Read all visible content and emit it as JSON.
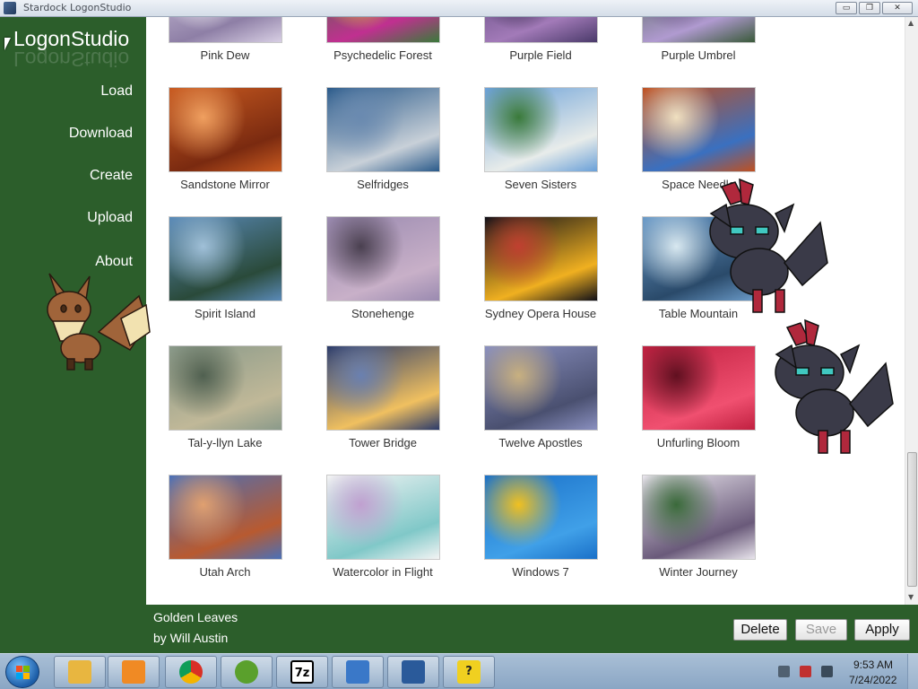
{
  "window": {
    "title": "Stardock LogonStudio",
    "controls": [
      "minimize",
      "maximize",
      "close"
    ],
    "minimize_glyph": "▭",
    "maximize_glyph": "❐",
    "close_glyph": "✕"
  },
  "sidebar": {
    "logo": "LogonStudio",
    "items": [
      {
        "label": "Load"
      },
      {
        "label": "Download"
      },
      {
        "label": "Create"
      },
      {
        "label": "Upload"
      },
      {
        "label": "About"
      }
    ],
    "background": "#2c5e2b"
  },
  "gallery": {
    "tiles": [
      {
        "label": "Pink Dew",
        "colors": [
          "#d8cfe4",
          "#8e7fa6",
          "#ffffff"
        ]
      },
      {
        "label": "Psychedelic Forest",
        "colors": [
          "#3a7a3a",
          "#c03090",
          "#f2d13a"
        ]
      },
      {
        "label": "Purple Field",
        "colors": [
          "#4a3a6a",
          "#a27ab8",
          "#2c2040"
        ]
      },
      {
        "label": "Purple Umbrel",
        "colors": [
          "#3a5a3a",
          "#b09ad0",
          "#6a4a8a"
        ]
      },
      {
        "label": "Sandstone Mirror",
        "colors": [
          "#c85a20",
          "#7a2a10",
          "#f0a060"
        ]
      },
      {
        "label": "Selfridges",
        "colors": [
          "#2a5a8a",
          "#c8d0d8",
          "#6a8ab0"
        ]
      },
      {
        "label": "Seven Sisters",
        "colors": [
          "#6aa0d8",
          "#e8ecea",
          "#3a7a3a"
        ]
      },
      {
        "label": "Space Needle",
        "colors": [
          "#c05020",
          "#3a70c0",
          "#f0e0c0"
        ]
      },
      {
        "label": "Spirit Island",
        "colors": [
          "#5a8ab8",
          "#2a4a3a",
          "#a0c0d8"
        ]
      },
      {
        "label": "Stonehenge",
        "colors": [
          "#9a8ab0",
          "#c8b0c8",
          "#4a4050"
        ]
      },
      {
        "label": "Sydney Opera House",
        "colors": [
          "#101018",
          "#f0b020",
          "#c04030"
        ]
      },
      {
        "label": "Table Mountain",
        "colors": [
          "#6a9ac8",
          "#2a4a6a",
          "#d8e8f0"
        ]
      },
      {
        "label": "Tal-y-llyn Lake",
        "colors": [
          "#8a9a8a",
          "#c0b898",
          "#506050"
        ]
      },
      {
        "label": "Tower Bridge",
        "colors": [
          "#2a3a6a",
          "#f0c060",
          "#6a80b0"
        ]
      },
      {
        "label": "Twelve Apostles",
        "colors": [
          "#8a90c0",
          "#4a5070",
          "#c8b080"
        ]
      },
      {
        "label": "Unfurling Bloom",
        "colors": [
          "#c02040",
          "#f05070",
          "#601020"
        ]
      },
      {
        "label": "Utah Arch",
        "colors": [
          "#4a70b8",
          "#b85a30",
          "#e0a070"
        ]
      },
      {
        "label": "Watercolor in Flight",
        "colors": [
          "#f4f4f4",
          "#80c8c8",
          "#c0a0d0"
        ]
      },
      {
        "label": "Windows 7",
        "colors": [
          "#1a70c8",
          "#40a0e8",
          "#f0c020"
        ]
      },
      {
        "label": "Winter Journey",
        "colors": [
          "#e8e4ec",
          "#6a5a7a",
          "#3a6a3a"
        ]
      }
    ]
  },
  "selection": {
    "name": "Golden Leaves",
    "author": "by Will Austin"
  },
  "buttons": {
    "delete": "Delete",
    "save": "Save",
    "apply": "Apply"
  },
  "taskbar": {
    "apps": [
      {
        "icon": "explorer-folder-icon",
        "color": "#e8b640"
      },
      {
        "icon": "media-player-icon",
        "color": "#f08a24"
      },
      {
        "icon": "chrome-icon",
        "color": "#d93025"
      },
      {
        "icon": "green-app-icon",
        "color": "#5aa02c"
      },
      {
        "icon": "7zip-icon",
        "color": "#1a1a1a"
      },
      {
        "icon": "control-panel-icon",
        "color": "#3a78c8"
      },
      {
        "icon": "logonstudio-icon",
        "color": "#2a5a9a"
      },
      {
        "icon": "help-icon",
        "color": "#f0d020"
      }
    ],
    "seven_zip_label": "7z",
    "help_label": "?",
    "time": "9:53 AM",
    "date": "7/24/2022"
  },
  "overlays": {
    "eevee_colors": {
      "body": "#a0643a",
      "cream": "#f2e2b0",
      "dark": "#4a2c18"
    },
    "zorua_colors": {
      "body": "#3a3a48",
      "tuft": "#b0283c",
      "eye": "#40c8c0"
    }
  }
}
